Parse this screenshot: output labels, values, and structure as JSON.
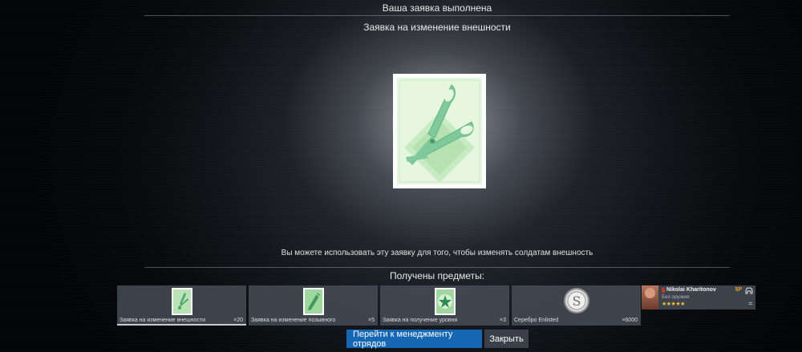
{
  "header": {
    "title": "Ваша заявка выполнена"
  },
  "main": {
    "subtitle": "Заявка на изменение внешности",
    "card_icon": "scissors-icon",
    "description": "Вы можете использовать эту заявку для того, чтобы изменять солдатам внешность",
    "received_label": "Получены предметы:"
  },
  "items": [
    {
      "name": "Заявка на изменение внешности",
      "count": "×20",
      "icon": "scissors-icon",
      "selected": true
    },
    {
      "name": "Заявка на изменение позывного",
      "count": "×5",
      "icon": "pencil-icon"
    },
    {
      "name": "Заявка на получение уровня",
      "count": "×3",
      "icon": "star-icon"
    },
    {
      "name": "Серебро Enlisted",
      "count": "×6000",
      "icon": "silver-coin-icon"
    }
  ],
  "soldier": {
    "name": "Nikolai Kharitonov",
    "weapon": "Без оружия",
    "stars": "★★★★★",
    "sp_label": "5P",
    "equip_glyph": "="
  },
  "buttons": {
    "manage_label": "Перейти к менеджменту отрядов",
    "close_label": "Закрыть"
  },
  "colors": {
    "accent": "#1668b4",
    "card_green": "#7fc99a",
    "star": "#f0c233"
  }
}
